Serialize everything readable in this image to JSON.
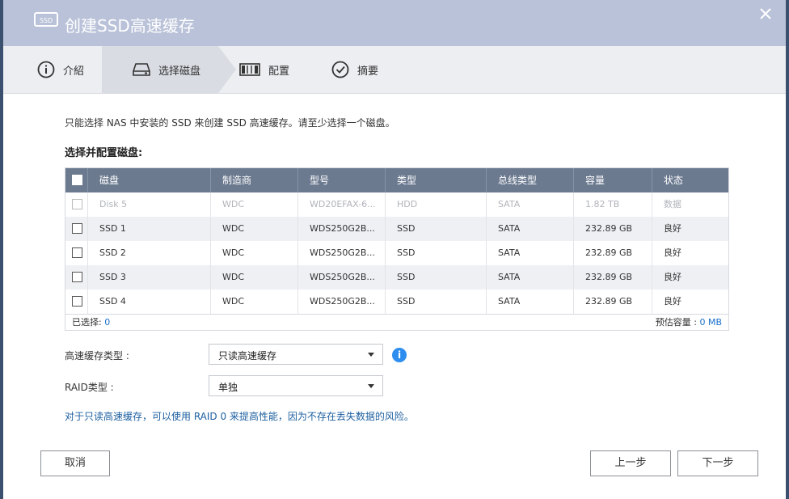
{
  "window": {
    "title": "创建SSD高速缓存",
    "title_icon": "ssd-icon",
    "close_icon": "close-icon"
  },
  "steps": [
    {
      "label": "介紹",
      "icon": "info-circle-icon",
      "active": false
    },
    {
      "label": "选择磁盘",
      "icon": "disk-drive-icon",
      "active": true
    },
    {
      "label": "配置",
      "icon": "config-icon",
      "active": false
    },
    {
      "label": "摘要",
      "icon": "check-circle-icon",
      "active": false
    }
  ],
  "intro_text": "只能选择 NAS 中安装的 SSD 来创建 SSD 高速缓存。请至少选择一个磁盘。",
  "section_title": "选择并配置磁盘:",
  "table": {
    "columns": [
      "磁盘",
      "制造商",
      "型号",
      "类型",
      "总线类型",
      "容量",
      "状态"
    ],
    "rows": [
      {
        "cells": [
          "Disk 5",
          "WDC",
          "WD20EFAX-6...",
          "HDD",
          "SATA",
          "1.82 TB",
          "数据"
        ],
        "disabled": true
      },
      {
        "cells": [
          "SSD 1",
          "WDC",
          "WDS250G2B...",
          "SSD",
          "SATA",
          "232.89 GB",
          "良好"
        ],
        "disabled": false
      },
      {
        "cells": [
          "SSD 2",
          "WDC",
          "WDS250G2B...",
          "SSD",
          "SATA",
          "232.89 GB",
          "良好"
        ],
        "disabled": false
      },
      {
        "cells": [
          "SSD 3",
          "WDC",
          "WDS250G2B...",
          "SSD",
          "SATA",
          "232.89 GB",
          "良好"
        ],
        "disabled": false
      },
      {
        "cells": [
          "SSD 4",
          "WDC",
          "WDS250G2B...",
          "SSD",
          "SATA",
          "232.89 GB",
          "良好"
        ],
        "disabled": false
      }
    ],
    "footer": {
      "selected_label": "已选择: ",
      "selected_value": "0",
      "capacity_label": "预估容量 : ",
      "capacity_value": "0 MB"
    }
  },
  "cache_type": {
    "label": "高速缓存类型 :",
    "value": "只读高速缓存"
  },
  "raid_type": {
    "label": "RAID类型 :",
    "value": "单独"
  },
  "note": "对于只读高速缓存，可以使用 RAID 0 来提高性能，因为不存在丢失数据的风险。",
  "buttons": {
    "cancel": "取消",
    "back": "上一步",
    "next": "下一步"
  },
  "colors": {
    "accent": "#1a6fc9",
    "header": "#6c7a90",
    "titlebar": "#b9c2d8",
    "info": "#2d8ef0"
  }
}
